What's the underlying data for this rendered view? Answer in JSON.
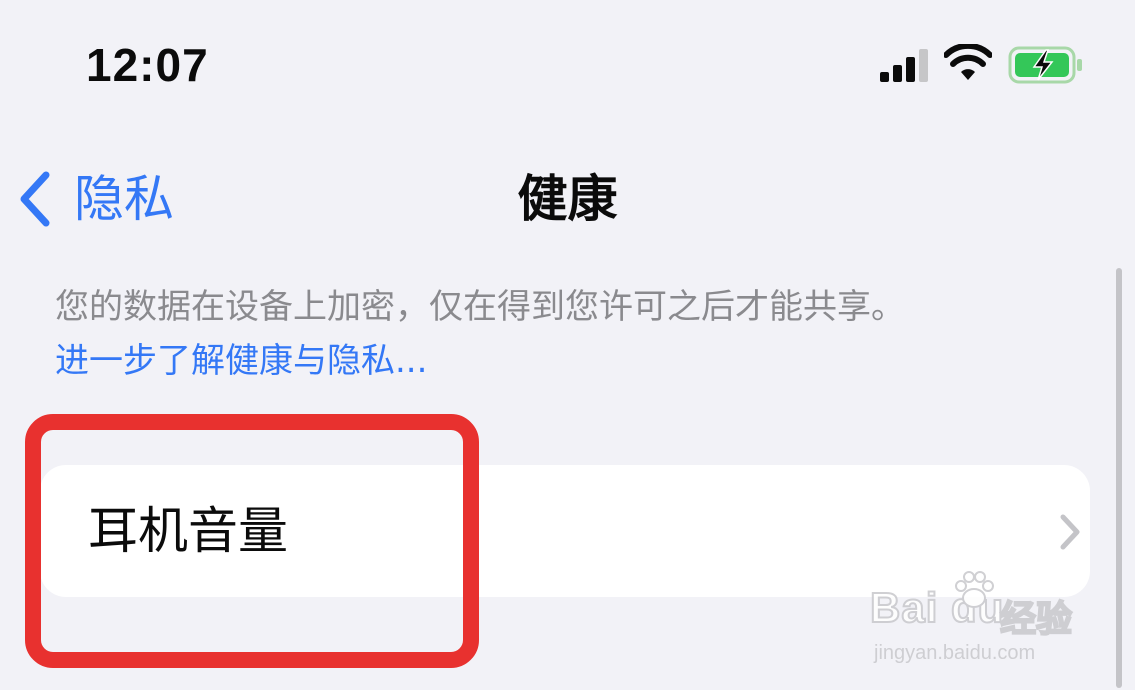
{
  "status_bar": {
    "time": "12:07",
    "signal_icon": "cellular-signal-icon",
    "wifi_icon": "wifi-icon",
    "battery_icon": "battery-charging-icon",
    "battery_color": "#34c759"
  },
  "nav": {
    "back_label": "隐私",
    "title": "健康"
  },
  "info": {
    "description": "您的数据在设备上加密，仅在得到您许可之后才能共享。",
    "link": "进一步了解健康与隐私..."
  },
  "list": {
    "items": [
      {
        "label": "耳机音量",
        "icon": "chevron-right-icon"
      }
    ]
  },
  "watermark": {
    "logo_text": "Bai du",
    "jingyan": "经验",
    "url": "jingyan.baidu.com"
  },
  "colors": {
    "accent": "#3478f6",
    "background": "#f2f2f7",
    "highlight": "#e8312f"
  }
}
